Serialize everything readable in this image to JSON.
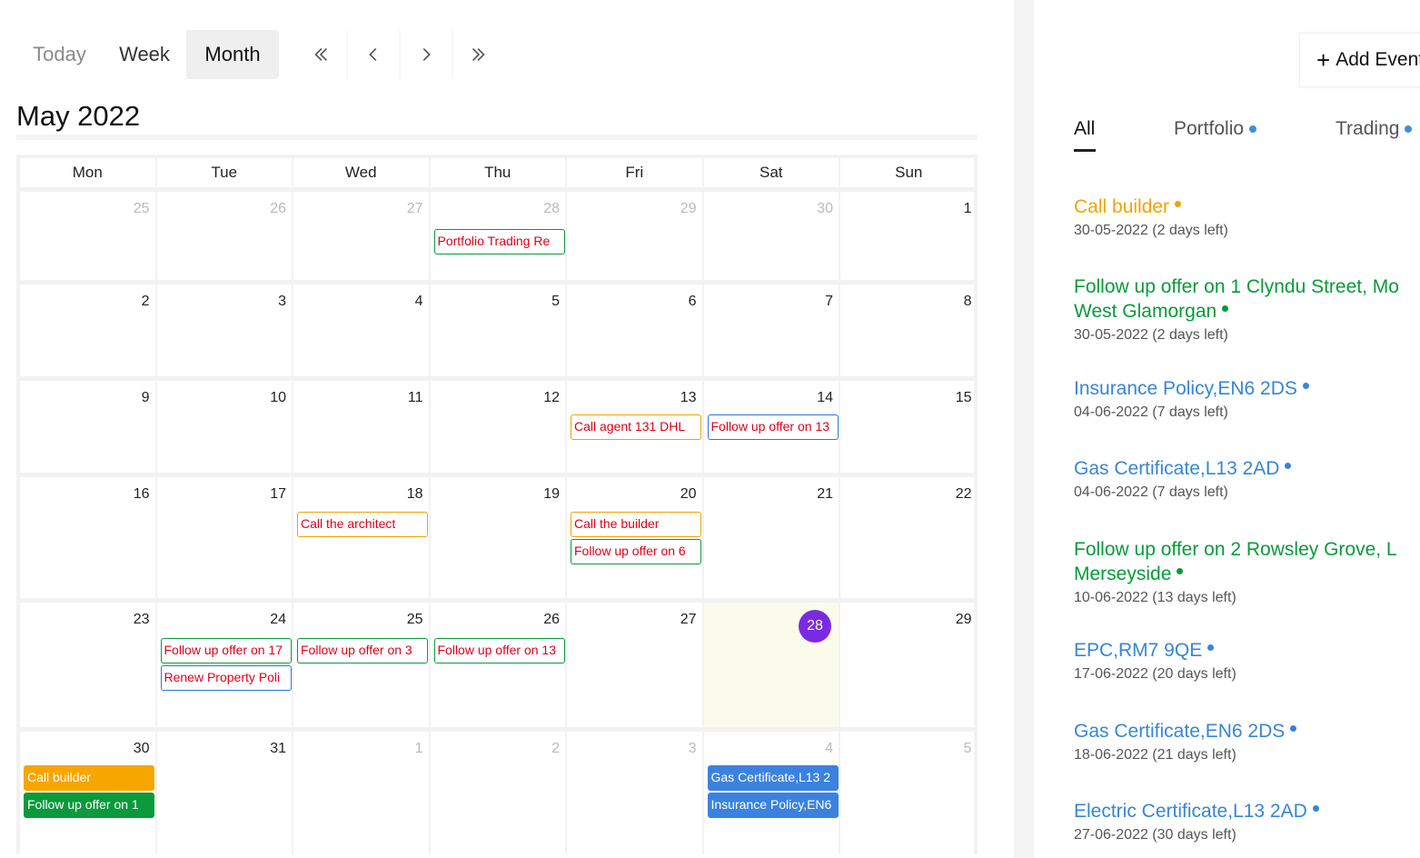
{
  "toolbar": {
    "today_label": "Today",
    "week_label": "Week",
    "month_label": "Month",
    "nav_icons": [
      "double-chevron-left-icon",
      "chevron-left-icon",
      "chevron-right-icon",
      "double-chevron-right-icon"
    ]
  },
  "calendar": {
    "title": "May 2022",
    "days_of_week": [
      "Mon",
      "Tue",
      "Wed",
      "Thu",
      "Fri",
      "Sat",
      "Sun"
    ],
    "today": "28",
    "weeks": [
      [
        "25",
        "26",
        "27",
        "28",
        "29",
        "30",
        "1"
      ],
      [
        "2",
        "3",
        "4",
        "5",
        "6",
        "7",
        "8"
      ],
      [
        "9",
        "10",
        "11",
        "12",
        "13",
        "14",
        "15"
      ],
      [
        "16",
        "17",
        "18",
        "19",
        "20",
        "21",
        "22"
      ],
      [
        "23",
        "24",
        "25",
        "26",
        "27",
        "28",
        "29"
      ],
      [
        "30",
        "31",
        "1",
        "2",
        "3",
        "4",
        "5"
      ]
    ],
    "events": {
      "w0_thu": "Portfolio Trading Re",
      "w2_fri": "Call agent 131 DHL",
      "w2_sat": "Follow up offer on 13",
      "w3_wed": "Call the architect",
      "w3_fri_1": "Call the builder",
      "w3_fri_2": "Follow up offer on 6",
      "w4_tue_1": "Follow up offer on 17",
      "w4_tue_2": "Renew Property Poli",
      "w4_wed": "Follow up offer on 3",
      "w4_thu": "Follow up offer on 13",
      "w5_mon_1": "Call builder",
      "w5_mon_2": "Follow up offer on 1",
      "w5_sat_1": "Gas Certificate,L13 2",
      "w5_sat_2": "Insurance Policy,EN6"
    }
  },
  "side": {
    "add_event_label": "Add Event",
    "tabs": [
      "All",
      "Portfolio",
      "Trading"
    ],
    "upcoming": [
      {
        "title": "Call builder",
        "date": "30-05-2022 (2 days left)",
        "color": "#f2a300"
      },
      {
        "title": "Follow up offer on 1 Clyndu Street, Mo",
        "title2": "West Glamorgan",
        "date": "30-05-2022 (2 days left)",
        "color": "#079b38"
      },
      {
        "title": "Insurance Policy,EN6 2DS",
        "date": "04-06-2022 (7 days left)",
        "color": "#3586d8"
      },
      {
        "title": "Gas Certificate,L13 2AD",
        "date": "04-06-2022 (7 days left)",
        "color": "#3586d8"
      },
      {
        "title": "Follow up offer on 2 Rowsley Grove, L",
        "title2": "Merseyside",
        "date": "10-06-2022 (13 days left)",
        "color": "#079b38"
      },
      {
        "title": "EPC,RM7 9QE",
        "date": "17-06-2022 (20 days left)",
        "color": "#3586d8"
      },
      {
        "title": "Gas Certificate,EN6 2DS",
        "date": "18-06-2022 (21 days left)",
        "color": "#3586d8"
      },
      {
        "title": "Electric Certificate,L13 2AD",
        "date": "27-06-2022 (30 days left)",
        "color": "#3586d8"
      }
    ]
  }
}
